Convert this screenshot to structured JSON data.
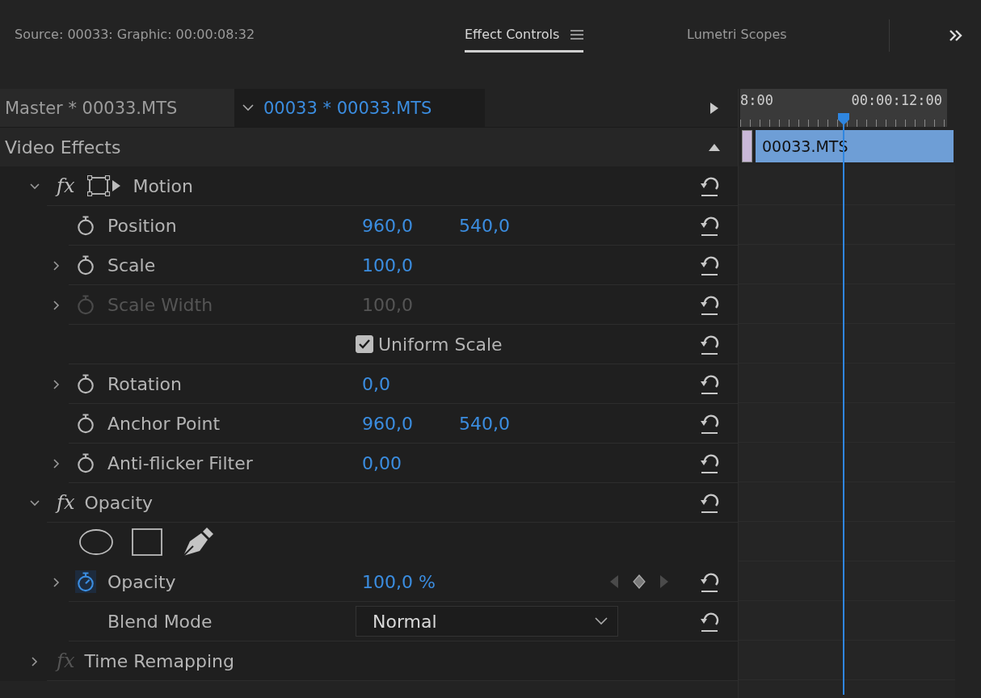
{
  "tabs": [
    {
      "label": "Source: 00033: Graphic: 00:00:08:32",
      "selected": false,
      "menu": false
    },
    {
      "label": "Effect Controls",
      "selected": true,
      "menu": true
    },
    {
      "label": "Lumetri Scopes",
      "selected": false,
      "menu": false
    }
  ],
  "clip_header": {
    "master": "Master * 00033.MTS",
    "clip": "00033 * 00033.MTS"
  },
  "section": "Video Effects",
  "timeline": {
    "ruler_start": "8:00",
    "ruler_mark": "00:00:12:00",
    "clip": "00033.MTS"
  },
  "effects": [
    {
      "label": "Motion",
      "badge": "fx",
      "expanded": true,
      "fx_active": true,
      "transform_icon": true,
      "reset": true,
      "children": [
        {
          "kind": "param",
          "label": "Position",
          "expandable": false,
          "disabled": false,
          "animated": false,
          "values": [
            "960,0",
            "540,0"
          ],
          "reset": true
        },
        {
          "kind": "param",
          "label": "Scale",
          "expandable": true,
          "disabled": false,
          "animated": false,
          "values": [
            "100,0"
          ],
          "reset": true
        },
        {
          "kind": "param",
          "label": "Scale Width",
          "expandable": true,
          "disabled": true,
          "values": [
            "100,0"
          ],
          "reset": true
        },
        {
          "kind": "checkbox",
          "label": "Uniform Scale",
          "checked": true,
          "reset": true
        },
        {
          "kind": "param",
          "label": "Rotation",
          "expandable": true,
          "disabled": false,
          "animated": false,
          "values": [
            "0,0"
          ],
          "reset": true
        },
        {
          "kind": "param",
          "label": "Anchor Point",
          "expandable": false,
          "disabled": false,
          "animated": false,
          "values": [
            "960,0",
            "540,0"
          ],
          "reset": true
        },
        {
          "kind": "param",
          "label": "Anti-flicker Filter",
          "expandable": true,
          "disabled": false,
          "animated": false,
          "values": [
            "0,00"
          ],
          "reset": true
        }
      ]
    },
    {
      "label": "Opacity",
      "badge": "fx",
      "expanded": true,
      "fx_active": true,
      "transform_icon": false,
      "reset": true,
      "children": [
        {
          "kind": "masks",
          "reset": false
        },
        {
          "kind": "param",
          "label": "Opacity",
          "expandable": true,
          "disabled": false,
          "animated": true,
          "values": [
            "100,0 %"
          ],
          "keyframe_nav": true,
          "reset": true
        },
        {
          "kind": "dropdown",
          "label": "Blend Mode",
          "value": "Normal",
          "reset": true
        }
      ]
    },
    {
      "label": "Time Remapping",
      "badge": "fx",
      "expanded": false,
      "fx_active": false,
      "transform_icon": false,
      "reset": false
    }
  ]
}
